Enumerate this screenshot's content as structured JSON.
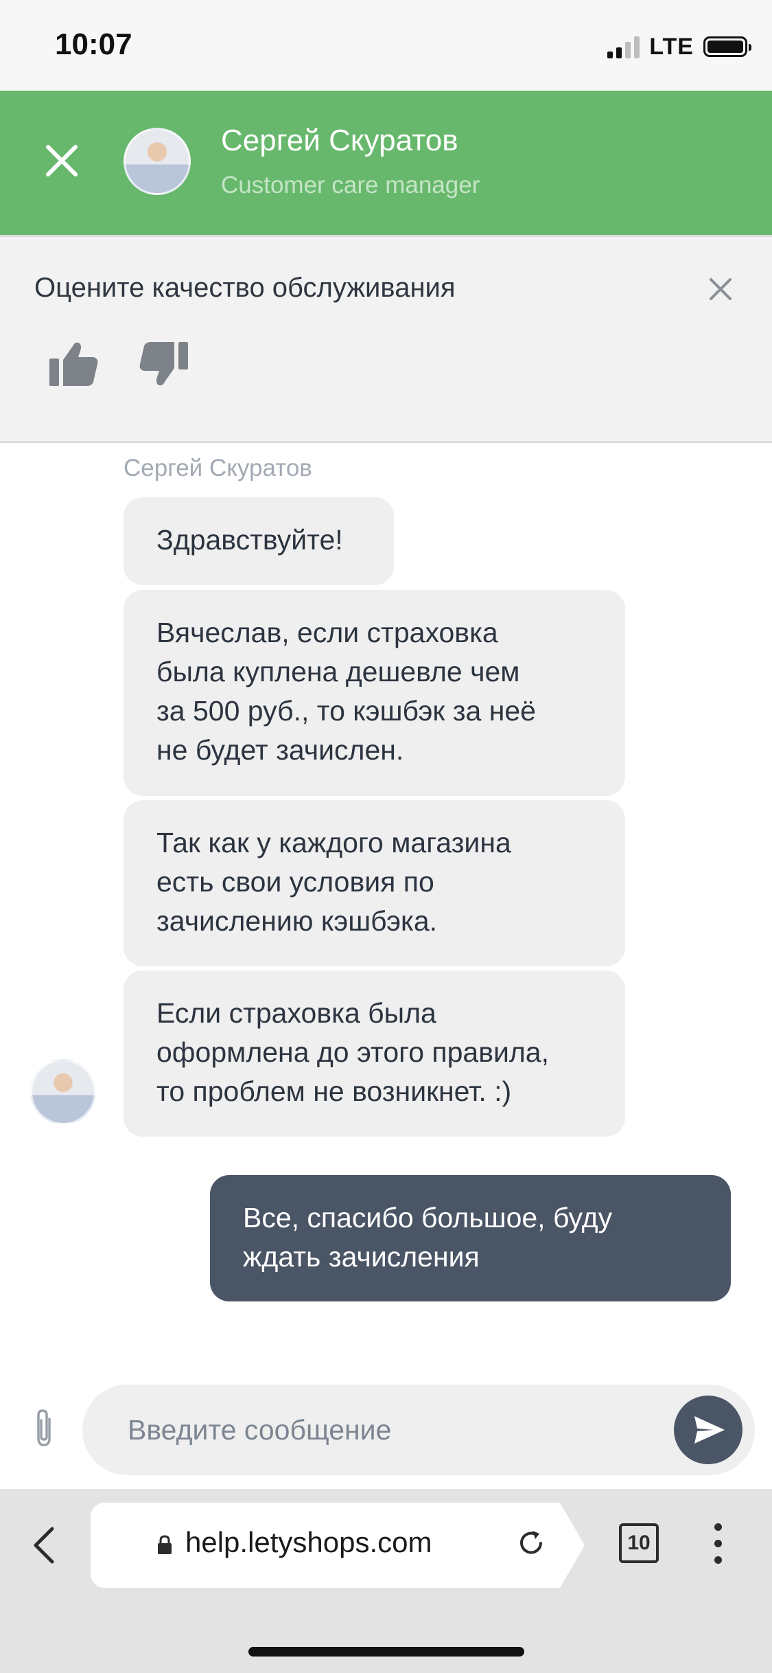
{
  "status_bar": {
    "time": "10:07",
    "network": "LTE"
  },
  "header": {
    "agent_name": "Сергей Скуратов",
    "agent_role": "Customer care manager"
  },
  "rating": {
    "prompt": "Оцените качество обслуживания"
  },
  "chat": {
    "sender_name": "Сергей Скуратов",
    "messages": [
      {
        "from": "agent",
        "lines": [
          "Здравствуйте!"
        ]
      },
      {
        "from": "agent",
        "lines": [
          "Вячеслав, если страховка",
          "была куплена дешевле чем",
          "за 500 руб., то кэшбэк за неё",
          "не будет зачислен."
        ]
      },
      {
        "from": "agent",
        "lines": [
          "Так как у каждого магазина",
          "есть свои условия по",
          "зачислению кэшбэка."
        ]
      },
      {
        "from": "agent",
        "lines": [
          "Если страховка была",
          "оформлена до этого правила,",
          "то проблем не возникнет. :)"
        ]
      },
      {
        "from": "user",
        "lines": [
          "Все, спасибо большое, буду",
          "ждать зачисления"
        ]
      }
    ]
  },
  "composer": {
    "placeholder": "Введите сообщение"
  },
  "browser": {
    "url": "help.letyshops.com",
    "tab_count": "10"
  },
  "colors": {
    "header_green": "#67b86d",
    "user_bubble": "#4a5566",
    "agent_bubble": "#efefef"
  }
}
